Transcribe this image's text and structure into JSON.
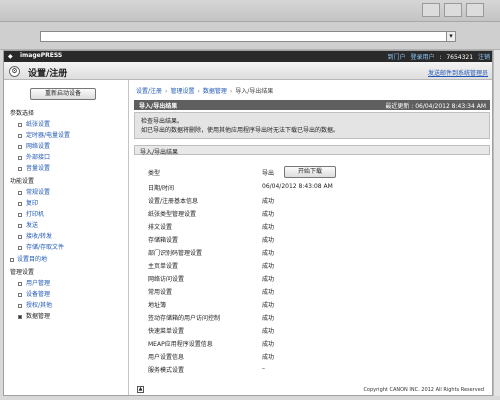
{
  "header": {
    "brand": "imagePRESS",
    "links": [
      "到门户",
      "登录用户",
      ":",
      "7654321",
      "注销"
    ]
  },
  "app": {
    "title": "设置/注册",
    "mail_link": "发送邮件到系统管理员"
  },
  "sidebar": {
    "restart_button": "重新启动设备",
    "groups": [
      {
        "heading": "参数选择",
        "items": [
          "纸张设置",
          "定时器/电量设置",
          "网络设置",
          "外部接口",
          "音量设置"
        ]
      },
      {
        "heading": "功能设置",
        "items": [
          "常规设置",
          "复印",
          "打印机",
          "发送",
          "接收/转发",
          "存储/存取文件"
        ]
      },
      {
        "heading": "设置目的地",
        "items": []
      },
      {
        "heading": "管理设置",
        "items": [
          "用户管理",
          "设备管理",
          "授权/其他",
          "数据管理"
        ]
      }
    ],
    "active_item": "数据管理"
  },
  "breadcrumb": {
    "items": [
      "设置/注册",
      "管理设置",
      "数据管理"
    ],
    "current": "导入/导出结果"
  },
  "result_section": {
    "title": "导入/导出结果",
    "updated_label": "最近更新",
    "updated_time": "06/04/2012 8:43:34 AM",
    "notice_line1": "检查导出结果。",
    "notice_line2": "如已导出的数据将删除，使用其他应用程序导出时无法下载已导出的数据。"
  },
  "detail_section": {
    "title": "导入/导出结果",
    "rows": [
      {
        "label": "类型",
        "value": "导出"
      },
      {
        "label": "日期/时间",
        "value": "06/04/2012 8:43:08 AM"
      },
      {
        "label": "设置/注册基本信息",
        "value": "成功"
      },
      {
        "label": "纸张类型管理设置",
        "value": "成功"
      },
      {
        "label": "排文设置",
        "value": "成功"
      },
      {
        "label": "存储箱设置",
        "value": "成功"
      },
      {
        "label": "部门识别码管理设置",
        "value": "成功"
      },
      {
        "label": "主页单设置",
        "value": "成功"
      },
      {
        "label": "网络访问设置",
        "value": "成功"
      },
      {
        "label": "常用设置",
        "value": "成功"
      },
      {
        "label": "地址簿",
        "value": "成功"
      },
      {
        "label": "签动存储箱的用户访问控制",
        "value": "成功"
      },
      {
        "label": "快速菜单设置",
        "value": "成功"
      },
      {
        "label": "MEAP应用程序设置信息",
        "value": "成功"
      },
      {
        "label": "用户设置信息",
        "value": "成功"
      },
      {
        "label": "服务模式设置",
        "value": "–"
      }
    ],
    "download_button": "开始下载"
  },
  "footer": {
    "copyright": "Copyright CANON INC. 2012 All Rights Reserved"
  }
}
